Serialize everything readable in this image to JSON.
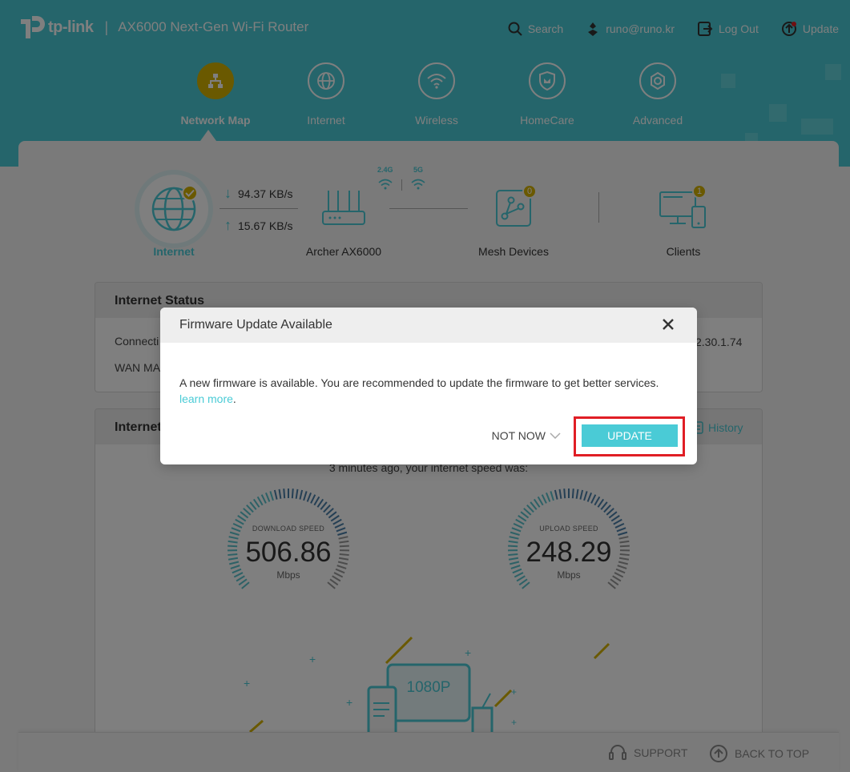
{
  "header": {
    "brand": "tp-link",
    "separator": "|",
    "product": "AX6000 Next-Gen Wi-Fi Router",
    "links": {
      "search": "Search",
      "account": "runo@runo.kr",
      "logout": "Log Out",
      "update": "Update"
    }
  },
  "nav": {
    "items": [
      {
        "label": "Network Map",
        "icon": "network-map-icon",
        "active": true
      },
      {
        "label": "Internet",
        "icon": "globe-icon",
        "active": false
      },
      {
        "label": "Wireless",
        "icon": "wifi-icon",
        "active": false
      },
      {
        "label": "HomeCare",
        "icon": "shield-icon",
        "active": false
      },
      {
        "label": "Advanced",
        "icon": "gear-icon",
        "active": false
      }
    ]
  },
  "topology": {
    "internet_label": "Internet",
    "download_rate": "94.37 KB/s",
    "upload_rate": "15.67 KB/s",
    "router_label": "Archer AX6000",
    "band_24": "2.4G",
    "band_5": "5G",
    "mesh_label": "Mesh Devices",
    "mesh_count": "0",
    "clients_label": "Clients",
    "clients_count": "1"
  },
  "internet_status": {
    "title": "Internet Status",
    "row1_label": "Connecti",
    "row1_value": "2.30.1.74",
    "row2_label": "WAN MA"
  },
  "speed_test": {
    "title": "Internet",
    "history_label": "History",
    "summary": "3 minutes ago, your internet speed was:",
    "download": {
      "caption": "DOWNLOAD SPEED",
      "value": "506.86",
      "unit": "Mbps"
    },
    "upload": {
      "caption": "UPLOAD SPEED",
      "value": "248.29",
      "unit": "Mbps"
    },
    "illustration_text": "1080P"
  },
  "footer": {
    "support": "SUPPORT",
    "back_to_top": "BACK TO TOP"
  },
  "modal": {
    "title": "Firmware Update Available",
    "message": "A new firmware is available. You are recommended to update the firmware to get better services.",
    "learn_more": "learn more",
    "learn_more_suffix": ".",
    "not_now": "NOT NOW",
    "update": "UPDATE"
  },
  "colors": {
    "brand_teal": "#4acbd6",
    "accent_gold": "#d4b300",
    "highlight_red": "#e01e25"
  }
}
